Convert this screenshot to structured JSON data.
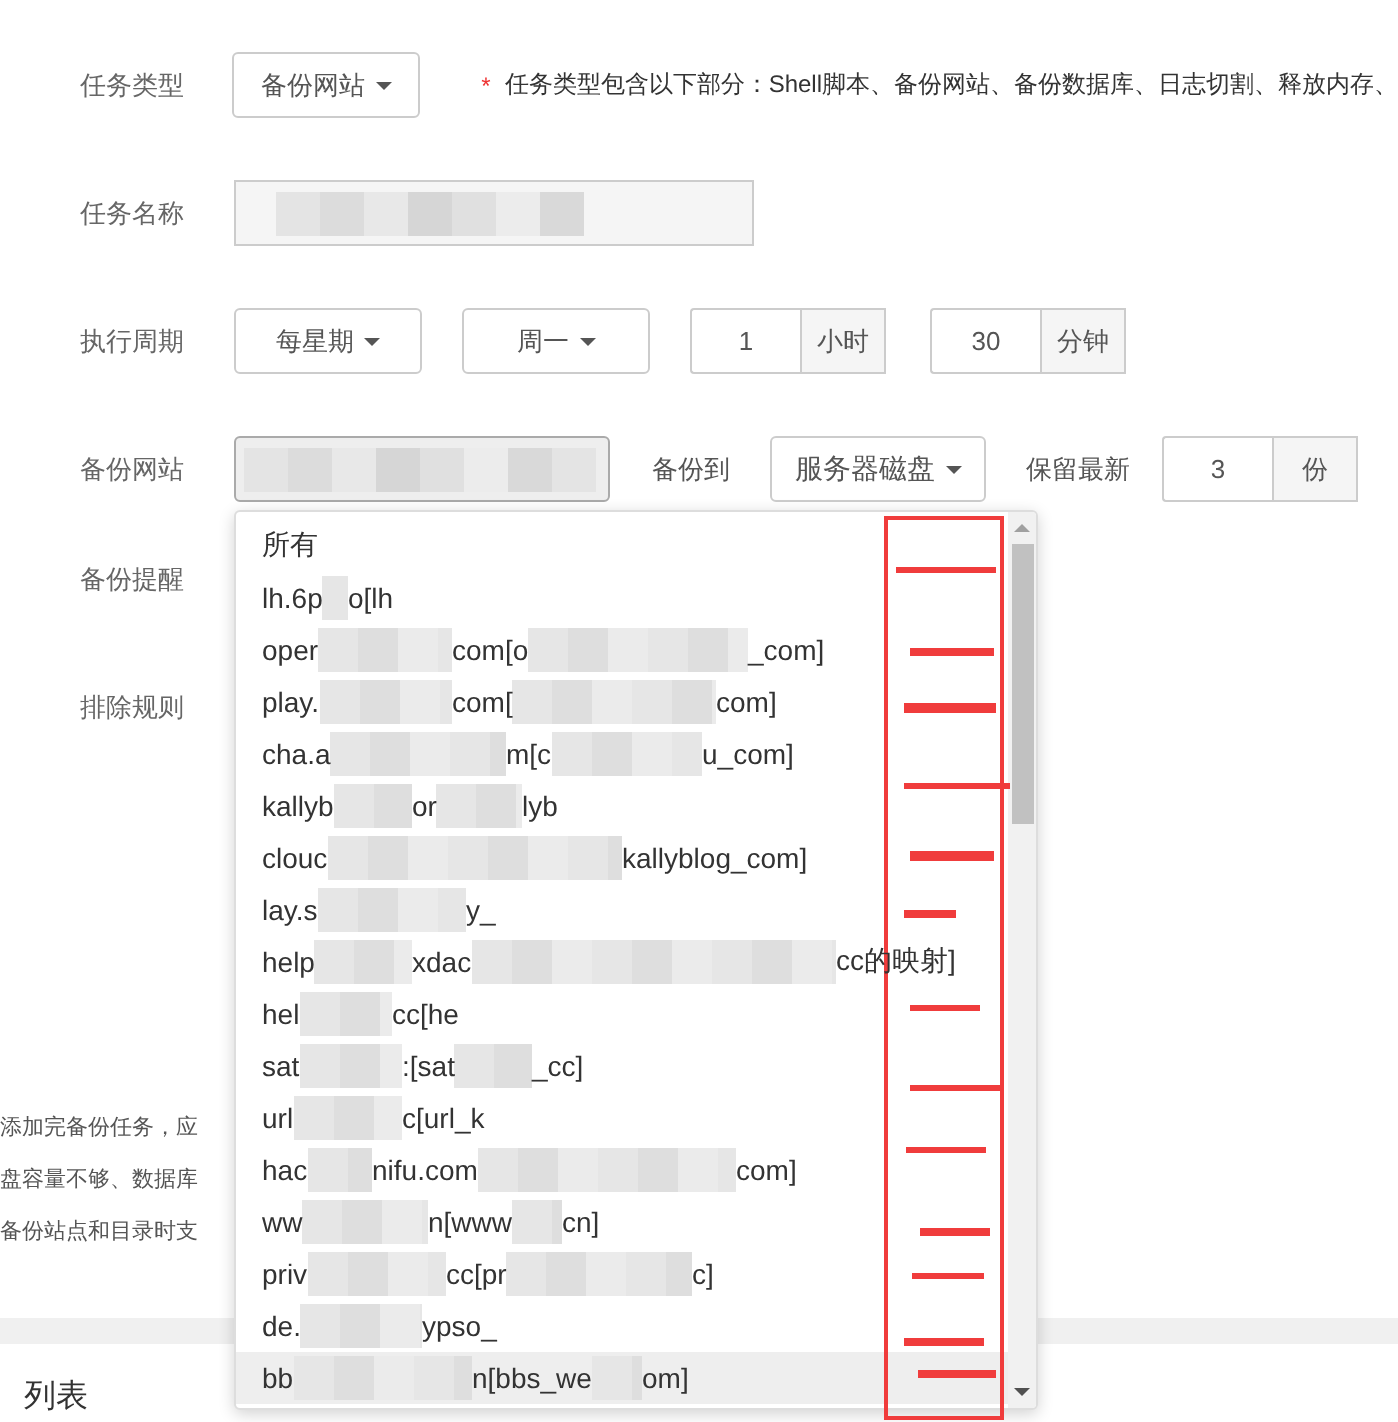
{
  "form": {
    "task_type": {
      "label": "任务类型",
      "value": "备份网站",
      "note_mark": "*",
      "note": "任务类型包含以下部分：Shell脚本、备份网站、备份数据库、日志切割、释放内存、"
    },
    "task_name": {
      "label": "任务名称"
    },
    "schedule": {
      "label": "执行周期",
      "period": "每星期",
      "weekday": "周一",
      "hour": "1",
      "hour_unit": "小时",
      "minute": "30",
      "minute_unit": "分钟"
    },
    "backup_site": {
      "label": "备份网站",
      "target_label": "备份到",
      "target": "服务器磁盘",
      "keep_label": "保留最新",
      "keep": "3",
      "keep_unit": "份"
    },
    "backup_alert": {
      "label": "备份提醒"
    },
    "exclude_rules": {
      "label": "排除规则"
    },
    "notes": [
      "添加完备份任务，应",
      "盘容量不够、数据库",
      "备份站点和目录时支"
    ],
    "section_title": "列表"
  },
  "site_dropdown": {
    "items": [
      {
        "parts": [
          "所有"
        ],
        "selected": false
      },
      {
        "parts": [
          "lh.6p",
          "o[lh"
        ],
        "selected": false
      },
      {
        "parts": [
          "oper",
          "com[o",
          "_com]"
        ],
        "selected": false
      },
      {
        "parts": [
          "play.",
          "com[",
          "com]"
        ],
        "selected": false
      },
      {
        "parts": [
          "cha.a",
          "m[c",
          "u_com]"
        ],
        "selected": false
      },
      {
        "parts": [
          "kallyb",
          "or",
          "lyb"
        ],
        "selected": false
      },
      {
        "parts": [
          "clouc",
          "kallyblog_com]"
        ],
        "selected": false
      },
      {
        "parts": [
          "lay.s",
          "y_"
        ],
        "selected": false
      },
      {
        "parts": [
          "help",
          "xdac",
          "cc的映射]"
        ],
        "selected": false
      },
      {
        "parts": [
          "hel",
          "cc[he"
        ],
        "selected": false
      },
      {
        "parts": [
          "sat",
          ":[sat",
          "_cc]"
        ],
        "selected": false
      },
      {
        "parts": [
          "url",
          "c[url_k"
        ],
        "selected": false
      },
      {
        "parts": [
          "hac",
          "nifu.com",
          "com]"
        ],
        "selected": false
      },
      {
        "parts": [
          "ww",
          "n[www",
          "cn]"
        ],
        "selected": false
      },
      {
        "parts": [
          "priv",
          "cc[pr",
          "c]"
        ],
        "selected": false
      },
      {
        "parts": [
          "de.",
          "ypso_"
        ],
        "selected": false
      },
      {
        "parts": [
          "bb",
          "n[bbs_we",
          "om]"
        ],
        "selected": true
      }
    ]
  }
}
